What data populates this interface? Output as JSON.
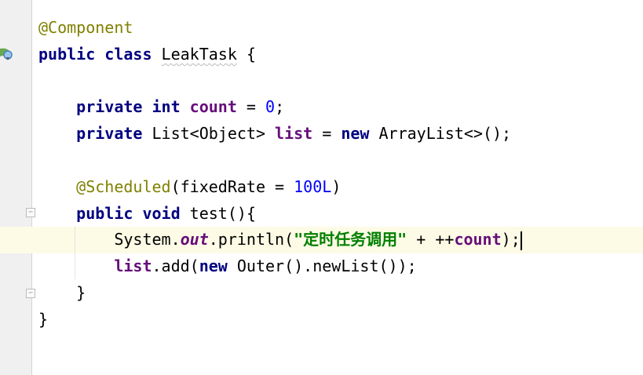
{
  "editor": {
    "lines": [
      [
        [
          "@Component",
          "ann"
        ]
      ],
      [
        [
          "public class ",
          "kw"
        ],
        [
          "LeakTask",
          "under"
        ],
        [
          " {",
          ""
        ]
      ],
      [],
      [
        [
          "    ",
          ""
        ],
        [
          "private int ",
          "kw"
        ],
        [
          "count",
          "field"
        ],
        [
          " = ",
          ""
        ],
        [
          "0",
          "num"
        ],
        [
          ";",
          ""
        ]
      ],
      [
        [
          "    ",
          ""
        ],
        [
          "private ",
          "kw"
        ],
        [
          "List<Object> ",
          ""
        ],
        [
          "list",
          "field"
        ],
        [
          " = ",
          ""
        ],
        [
          "new ",
          "kw"
        ],
        [
          "ArrayList<>();",
          ""
        ]
      ],
      [],
      [
        [
          "    ",
          ""
        ],
        [
          "@Scheduled",
          "ann"
        ],
        [
          "(fixedRate = ",
          ""
        ],
        [
          "100L",
          "num"
        ],
        [
          ")",
          ""
        ]
      ],
      [
        [
          "    ",
          ""
        ],
        [
          "public void ",
          "kw"
        ],
        [
          "test(){",
          ""
        ]
      ],
      [
        [
          "        System.",
          ""
        ],
        [
          "out",
          "static"
        ],
        [
          ".println(",
          ""
        ],
        [
          "\"定时任务调用\"",
          "str"
        ],
        [
          " + ++",
          ""
        ],
        [
          "count",
          "field"
        ],
        [
          ");",
          ""
        ]
      ],
      [
        [
          "        ",
          ""
        ],
        [
          "list",
          "field"
        ],
        [
          ".add(",
          ""
        ],
        [
          "new ",
          "kw"
        ],
        [
          "Outer().newList());",
          ""
        ]
      ],
      [
        [
          "    }",
          ""
        ]
      ],
      [
        [
          "}",
          ""
        ]
      ]
    ],
    "caret_line": 9,
    "gutter_icons": [
      "spring-bean-icon",
      "fold-icon",
      "fold-icon"
    ]
  }
}
